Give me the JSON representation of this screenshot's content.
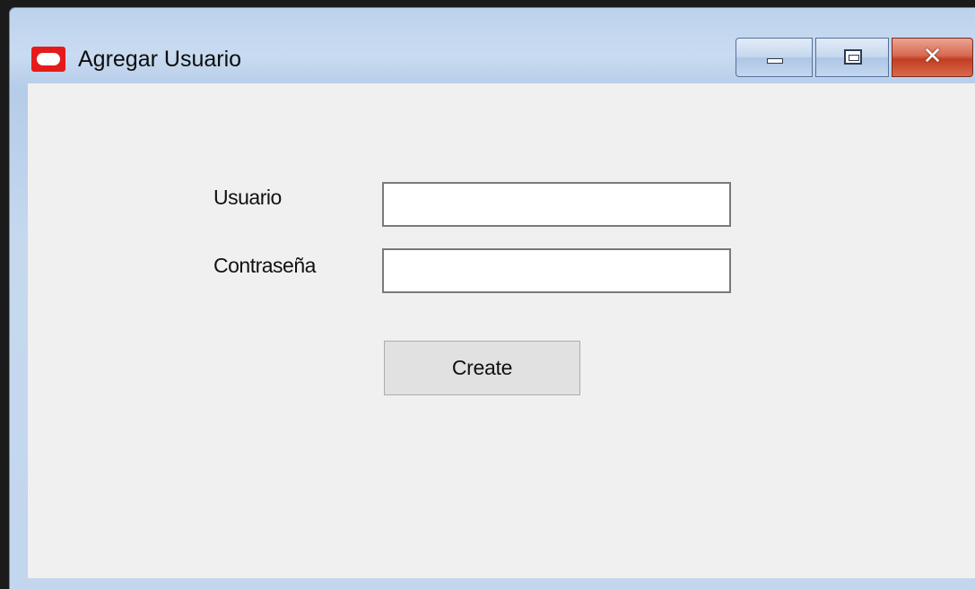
{
  "window": {
    "title": "Agregar Usuario",
    "icon": "oracle-app-icon",
    "controls": {
      "minimize_icon": "minimize-icon",
      "maximize_icon": "maximize-icon",
      "close_icon": "close-icon",
      "close_glyph": "✕"
    }
  },
  "form": {
    "user_label": "Usuario",
    "user_value": "",
    "password_label": "Contraseña",
    "password_value": "",
    "create_label": "Create"
  },
  "colors": {
    "titlebar": "#c2d6ee",
    "client_background": "#f0f0f0",
    "close_button": "#c8462b",
    "app_icon": "#e51b1b"
  }
}
